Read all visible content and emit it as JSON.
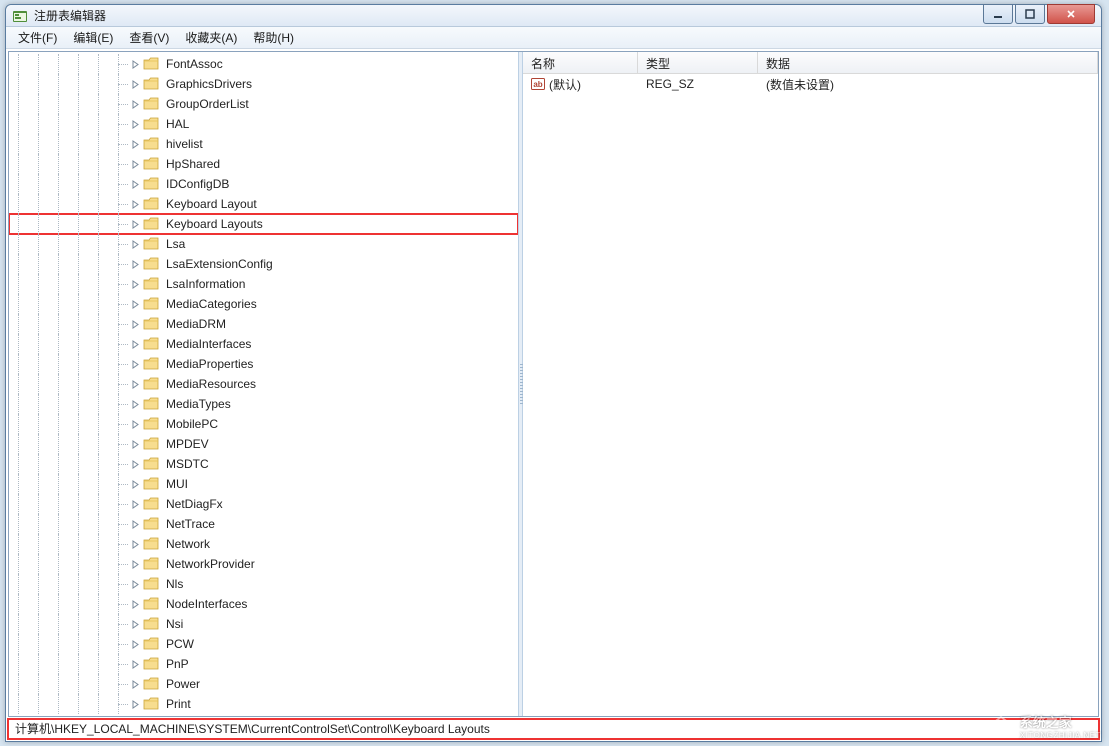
{
  "window": {
    "title": "注册表编辑器"
  },
  "menu": {
    "file": "文件(F)",
    "edit": "编辑(E)",
    "view": "查看(V)",
    "favorites": "收藏夹(A)",
    "help": "帮助(H)"
  },
  "tree": {
    "indent_levels": 6,
    "selected_index": 8,
    "items": [
      "FontAssoc",
      "GraphicsDrivers",
      "GroupOrderList",
      "HAL",
      "hivelist",
      "HpShared",
      "IDConfigDB",
      "Keyboard Layout",
      "Keyboard Layouts",
      "Lsa",
      "LsaExtensionConfig",
      "LsaInformation",
      "MediaCategories",
      "MediaDRM",
      "MediaInterfaces",
      "MediaProperties",
      "MediaResources",
      "MediaTypes",
      "MobilePC",
      "MPDEV",
      "MSDTC",
      "MUI",
      "NetDiagFx",
      "NetTrace",
      "Network",
      "NetworkProvider",
      "Nls",
      "NodeInterfaces",
      "Nsi",
      "PCW",
      "PnP",
      "Power",
      "Print"
    ]
  },
  "list": {
    "headers": {
      "name": "名称",
      "type": "类型",
      "data": "数据"
    },
    "rows": [
      {
        "name": "(默认)",
        "type": "REG_SZ",
        "data": "(数值未设置)"
      }
    ]
  },
  "statusbar": {
    "path": "计算机\\HKEY_LOCAL_MACHINE\\SYSTEM\\CurrentControlSet\\Control\\Keyboard Layouts"
  },
  "watermark": {
    "text": "系统之家",
    "url": "XITONGZHIJIA.NET"
  }
}
